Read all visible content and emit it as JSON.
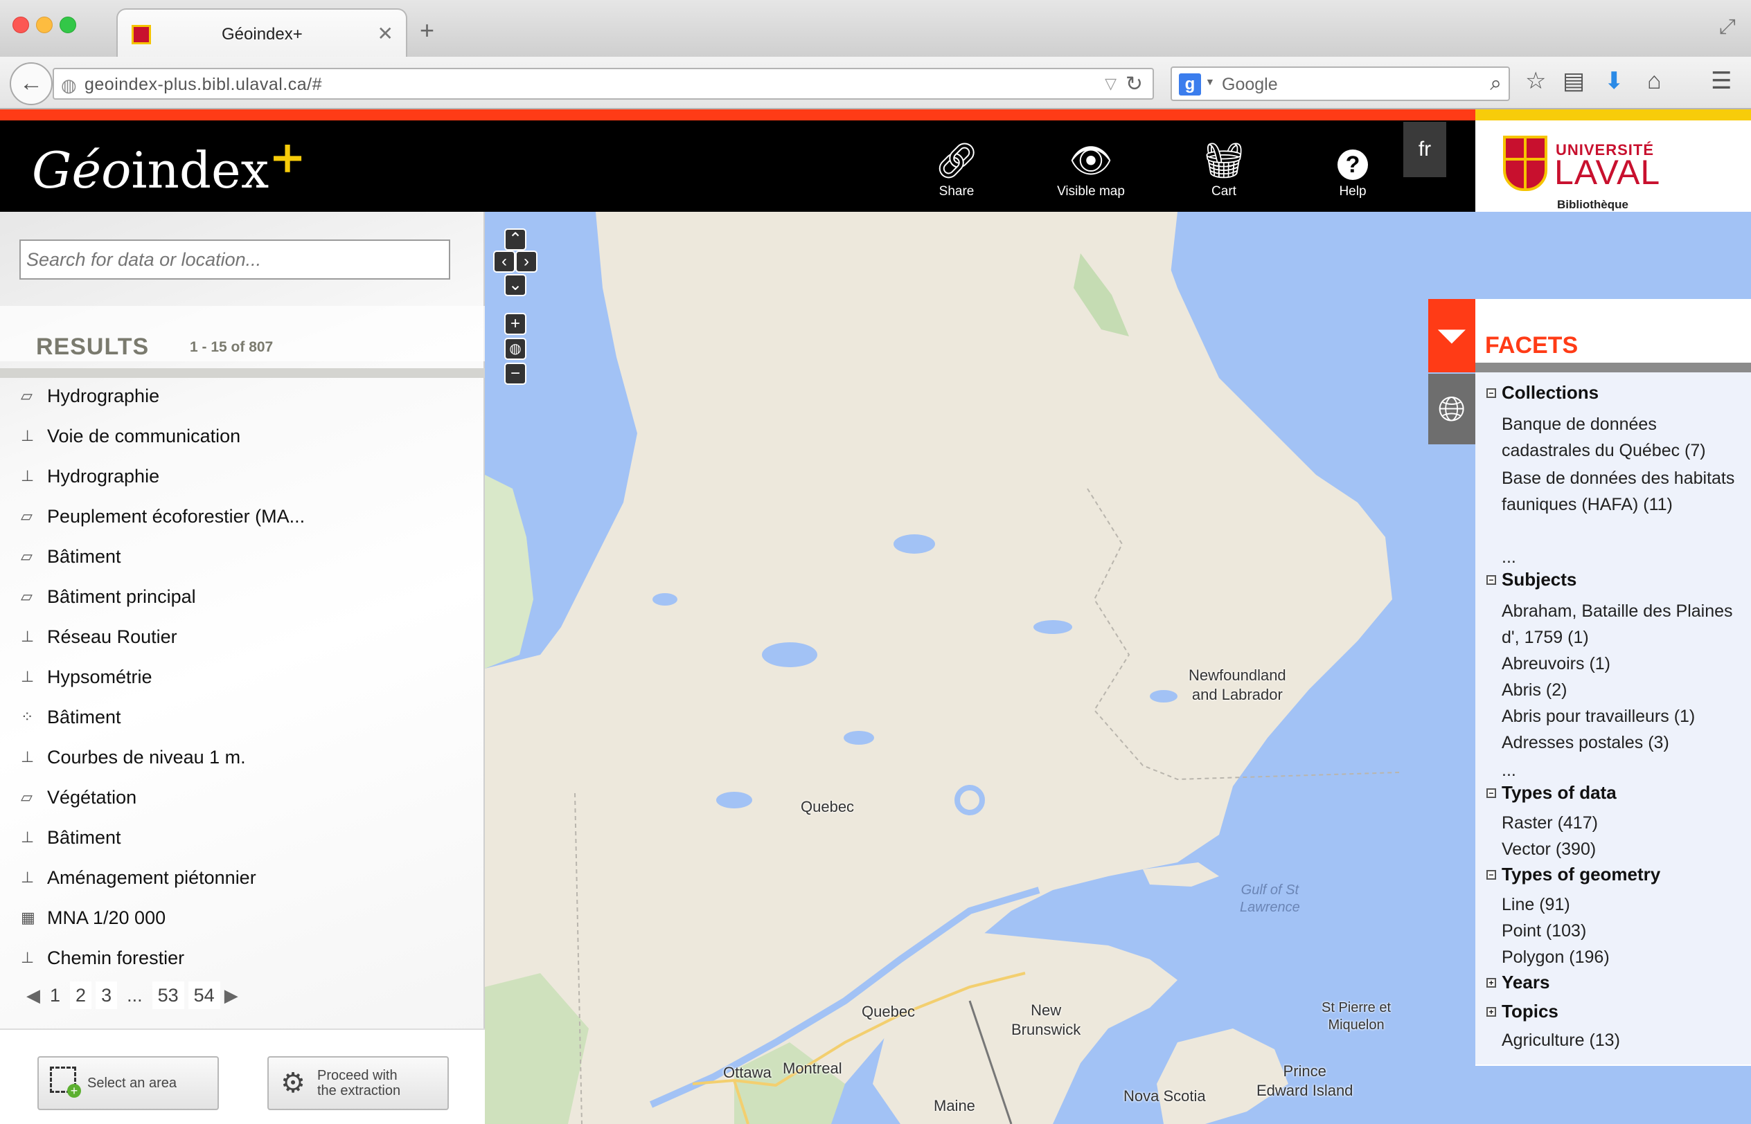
{
  "browser": {
    "tab_title": "Géoindex+",
    "new_tab": "+",
    "url": "geoindex-plus.bibl.ulaval.ca/#",
    "search_engine": "Google"
  },
  "header": {
    "buttons": [
      {
        "label": "Share",
        "icon": "link-icon"
      },
      {
        "label": "Visible map",
        "icon": "eye-icon"
      },
      {
        "label": "Cart",
        "icon": "basket-icon"
      },
      {
        "label": "Help",
        "icon": "question-icon"
      }
    ],
    "lang": "fr",
    "university_top": "UNIVERSITÉ",
    "university_name": "LAVAL",
    "university_sub": "Bibliothèque",
    "colors": {
      "accent": "#ff3b16",
      "yellow": "#f7cc0a"
    }
  },
  "search": {
    "placeholder": "Search for data or location..."
  },
  "results": {
    "title": "RESULTS",
    "count": "1 - 15 of 807",
    "items": [
      {
        "label": "Hydrographie",
        "geom": "polygon"
      },
      {
        "label": "Voie de communication",
        "geom": "line"
      },
      {
        "label": "Hydrographie",
        "geom": "line"
      },
      {
        "label": "Peuplement écoforestier (MA...",
        "geom": "polygon"
      },
      {
        "label": "Bâtiment",
        "geom": "polygon"
      },
      {
        "label": "Bâtiment principal",
        "geom": "polygon"
      },
      {
        "label": "Réseau Routier",
        "geom": "line"
      },
      {
        "label": "Hypsométrie",
        "geom": "line"
      },
      {
        "label": "Bâtiment",
        "geom": "point"
      },
      {
        "label": "Courbes de niveau 1 m.",
        "geom": "line"
      },
      {
        "label": "Végétation",
        "geom": "polygon"
      },
      {
        "label": "Bâtiment",
        "geom": "line"
      },
      {
        "label": "Aménagement piétonnier",
        "geom": "line"
      },
      {
        "label": "MNA 1/20 000",
        "geom": "raster"
      },
      {
        "label": "Chemin forestier",
        "geom": "line"
      }
    ],
    "pages": [
      "1",
      "2",
      "3",
      "...",
      "53",
      "54"
    ]
  },
  "actions": {
    "select_area": "Select an area",
    "proceed_line1": "Proceed with",
    "proceed_line2": "the extraction"
  },
  "map": {
    "labels": {
      "newfoundland": "Newfoundland\nand Labrador",
      "quebec_region": "Quebec",
      "gulf": "Gulf of St\nLawrence",
      "quebec_city": "Quebec",
      "new_brunswick": "New\nBrunswick",
      "st_pierre": "St Pierre et\nMiquelon",
      "pei": "Prince\nEdward Island",
      "ottawa": "Ottawa",
      "montreal": "Montreal",
      "nova_scotia": "Nova Scotia",
      "maine": "Maine"
    }
  },
  "facets": {
    "title": "FACETS",
    "groups": [
      {
        "name": "Collections",
        "toggle": "−",
        "values": [
          "Banque de données cadastrales du Québec (7)",
          "Base de données des habitats fauniques (HAFA) (11)",
          "..."
        ]
      },
      {
        "name": "Subjects",
        "toggle": "−",
        "values": [
          "Abraham, Bataille des Plaines d', 1759 (1)",
          "Abreuvoirs (1)",
          "Abris (2)",
          "Abris pour travailleurs (1)",
          "Adresses postales (3)",
          "..."
        ]
      },
      {
        "name": "Types of data",
        "toggle": "−",
        "values": [
          "Raster (417)",
          "Vector (390)"
        ]
      },
      {
        "name": "Types of geometry",
        "toggle": "−",
        "values": [
          "Line (91)",
          "Point (103)",
          "Polygon (196)"
        ]
      },
      {
        "name": "Years",
        "toggle": "+",
        "values": []
      },
      {
        "name": "Topics",
        "toggle": "+",
        "values": [
          "Agriculture (13)"
        ]
      }
    ]
  }
}
